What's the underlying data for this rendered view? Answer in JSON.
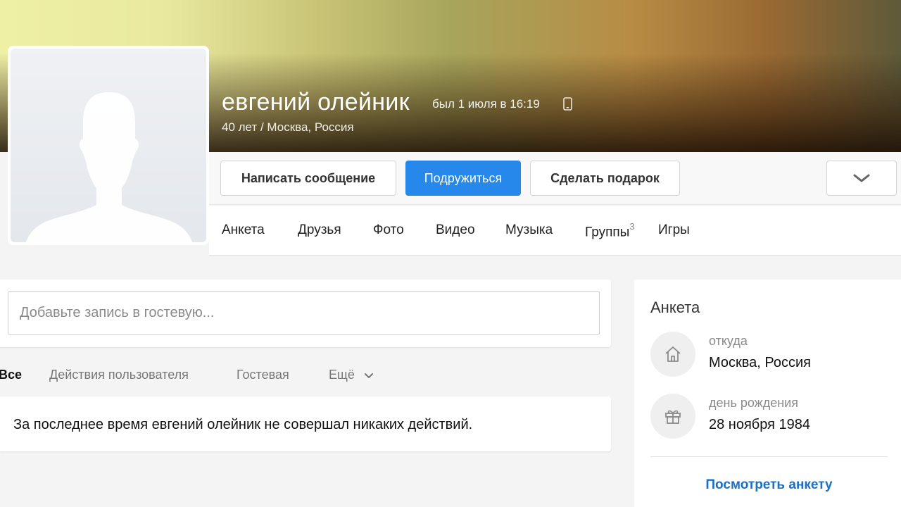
{
  "profile": {
    "name": "евгений олейник",
    "last_seen": "был 1 июля в 16:19",
    "subtitle": "40 лет / Москва, Россия"
  },
  "actions": {
    "message": "Написать сообщение",
    "add_friend": "Подружиться",
    "gift": "Сделать подарок"
  },
  "tabs": [
    {
      "label": "Анкета"
    },
    {
      "label": "Друзья"
    },
    {
      "label": "Фото"
    },
    {
      "label": "Видео"
    },
    {
      "label": "Музыка"
    },
    {
      "label": "Группы",
      "count": "3"
    },
    {
      "label": "Игры"
    }
  ],
  "guestbook": {
    "placeholder": "Добавьте запись в гостевую..."
  },
  "feed_filters": {
    "all": "Все",
    "user_actions": "Действия пользователя",
    "guestbook": "Гостевая",
    "more": "Ещё"
  },
  "feed_empty": "За последнее время евгений олейник не совершал никаких действий.",
  "about": {
    "title": "Анкета",
    "location_label": "откуда",
    "location_value": "Москва, Россия",
    "birthday_label": "день рождения",
    "birthday_value": "28 ноября 1984",
    "view_link": "Посмотреть анкету"
  },
  "colors": {
    "accent": "#2688eb",
    "link": "#1d6fc4"
  },
  "icons": {
    "device": "phone-icon",
    "more": "chevron-down-icon",
    "location": "house-icon",
    "birthday": "gift-icon"
  }
}
